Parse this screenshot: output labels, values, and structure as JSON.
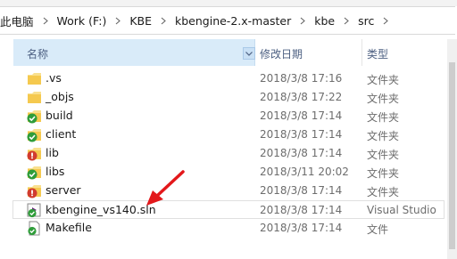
{
  "address_bar": {
    "crumbs": [
      "此电脑",
      "Work (F:)",
      "KBE",
      "kbengine-2.x-master",
      "kbe",
      "src"
    ]
  },
  "columns": {
    "name": "名称",
    "date": "修改日期",
    "type": "类型"
  },
  "files": [
    {
      "name": ".vs",
      "date": "2018/3/8 17:16",
      "type": "文件夹",
      "icon": "folder-icon"
    },
    {
      "name": "_objs",
      "date": "2018/3/8 17:22",
      "type": "文件夹",
      "icon": "folder-icon"
    },
    {
      "name": "build",
      "date": "2018/3/8 17:14",
      "type": "文件夹",
      "icon": "folder-synced-icon"
    },
    {
      "name": "client",
      "date": "2018/3/8 17:14",
      "type": "文件夹",
      "icon": "folder-synced-icon"
    },
    {
      "name": "lib",
      "date": "2018/3/8 17:14",
      "type": "文件夹",
      "icon": "folder-conflict-icon"
    },
    {
      "name": "libs",
      "date": "2018/3/11 20:02",
      "type": "文件夹",
      "icon": "folder-synced-icon"
    },
    {
      "name": "server",
      "date": "2018/3/8 17:14",
      "type": "文件夹",
      "icon": "folder-conflict-icon"
    },
    {
      "name": "kbengine_vs140.sln",
      "date": "2018/3/8 17:14",
      "type": "Visual Studio",
      "icon": "visual-studio-solution-icon"
    },
    {
      "name": "Makefile",
      "date": "2018/3/8 17:14",
      "type": "文件",
      "icon": "file-synced-icon"
    }
  ],
  "colors": {
    "header_bg": "#d9ebf9",
    "folder": "#f5c94f",
    "sync_ok": "#2f9d3a",
    "conflict": "#d13b2f",
    "arrow": "#e3181b"
  }
}
